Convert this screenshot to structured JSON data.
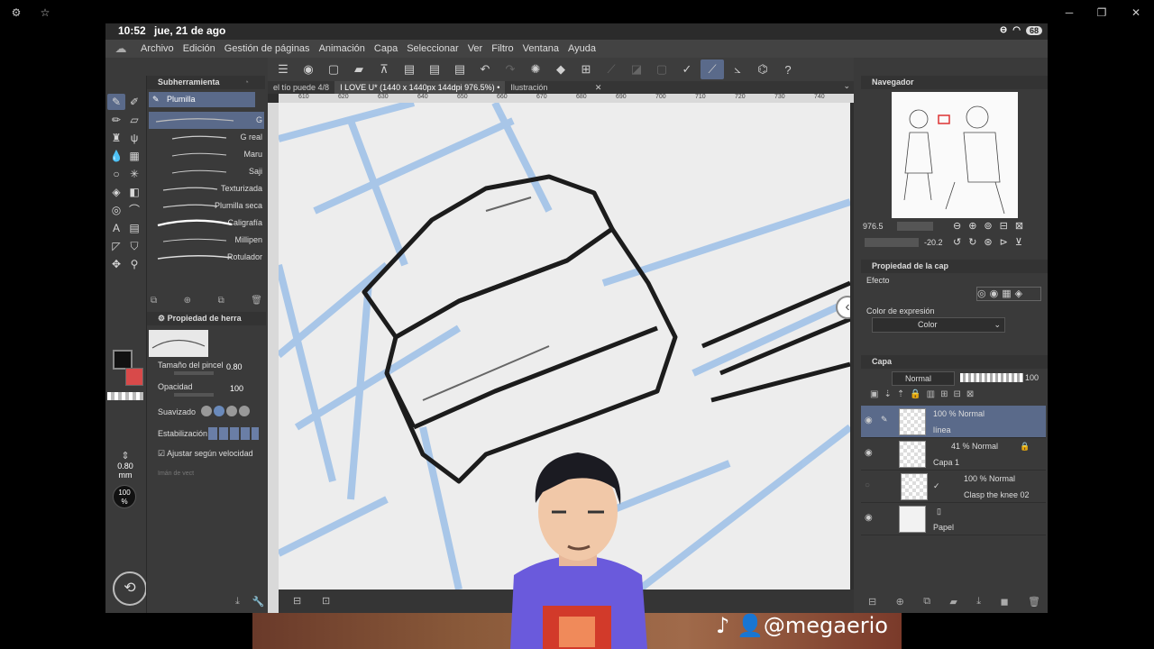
{
  "status": {
    "time": "10:52",
    "date": "jue, 21 de ago",
    "battery": "68"
  },
  "menu": [
    "Archivo",
    "Edición",
    "Gestión de páginas",
    "Animación",
    "Capa",
    "Seleccionar",
    "Ver",
    "Filtro",
    "Ventana",
    "Ayuda"
  ],
  "subtool": {
    "header": "Subherramienta",
    "selected": "Plumilla",
    "brushes": [
      "G",
      "G real",
      "Maru",
      "Saji",
      "Texturizada",
      "Plumilla seca",
      "Caligrafía",
      "Millipen",
      "Rotulador"
    ]
  },
  "toolprop": {
    "header": "Propiedad de herra",
    "size_label": "Tamaño del pincel",
    "size_value": "0.80",
    "opacity_label": "Opacidad",
    "opacity_value": "100",
    "smoothing_label": "Suavizado",
    "stabilization_label": "Estabilización",
    "velocity_label": "Ajustar según velocidad",
    "hidden_label": "Imán de vect"
  },
  "left_info": {
    "size": "0.80",
    "unit": "mm",
    "opacity": "100",
    "opacity_unit": "%"
  },
  "tabs": [
    "el tío puede 4/8",
    "I LOVE U* (1440 x 1440px 144dpi 976.5%)",
    "Ilustración"
  ],
  "ruler": [
    "610",
    "620",
    "630",
    "640",
    "650",
    "660",
    "670",
    "680",
    "690",
    "700",
    "710",
    "720",
    "730",
    "740"
  ],
  "navigator": {
    "header": "Navegador",
    "zoom": "976.5",
    "rotation": "-20.2"
  },
  "layerprop": {
    "header": "Propiedad de la cap",
    "effect_label": "Efecto",
    "expr_label": "Color de expresión",
    "expr_value": "Color"
  },
  "layers": {
    "header": "Capa",
    "blend": "Normal",
    "opacity": "100",
    "items": [
      {
        "mode": "100 % Normal",
        "name": "línea"
      },
      {
        "mode": "41 % Normal",
        "name": "Capa 1"
      },
      {
        "mode": "100 % Normal",
        "name": "Clasp the knee 02"
      },
      {
        "mode": "",
        "name": "Papel"
      }
    ]
  },
  "watermark": "@megaerio",
  "colors": {
    "main": "#111111",
    "sub": "#d84a4a",
    "accent": "#5a6a8a"
  }
}
